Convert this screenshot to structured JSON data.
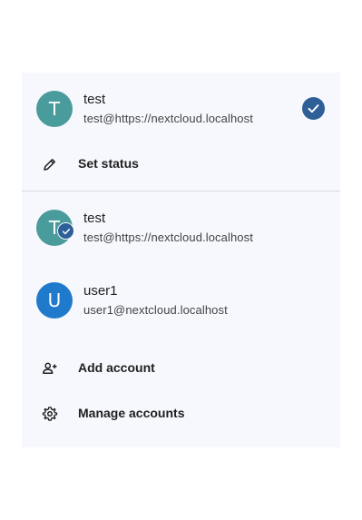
{
  "current_account": {
    "avatar_letter": "T",
    "name": "test",
    "email": "test@https://nextcloud.localhost",
    "selected_icon": "check-circle-icon"
  },
  "set_status": {
    "icon": "pencil-icon",
    "label": "Set status"
  },
  "accounts": [
    {
      "avatar_letter": "T",
      "name": "test",
      "email": "test@https://nextcloud.localhost",
      "badge_icon": "check-badge-icon"
    },
    {
      "avatar_letter": "U",
      "name": "user1",
      "email": "user1@nextcloud.localhost"
    }
  ],
  "actions": {
    "add_account": {
      "icon": "add-person-icon",
      "label": "Add account"
    },
    "manage_accounts": {
      "icon": "gear-icon",
      "label": "Manage accounts"
    }
  },
  "colors": {
    "panel_bg": "#f7f8fd",
    "avatar_teal": "#4a9b9c",
    "avatar_blue": "#1f7acc",
    "accent": "#2f5f97"
  }
}
